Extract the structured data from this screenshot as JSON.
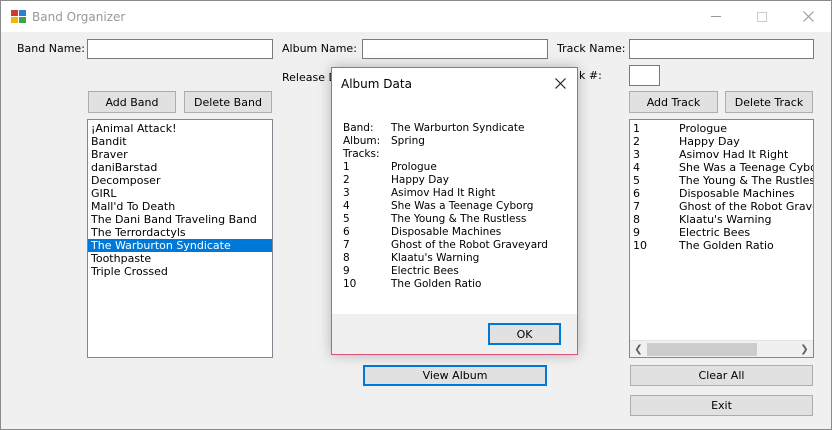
{
  "window": {
    "title": "Band Organizer"
  },
  "labels": {
    "band_name": "Band Name:",
    "album_name": "Album Name:",
    "track_name": "Track Name:",
    "release_date": "Release D",
    "track_number": "k #:"
  },
  "buttons": {
    "add_band": "Add Band",
    "delete_band": "Delete Band",
    "add_track": "Add Track",
    "delete_track": "Delete Track",
    "view_album": "View Album",
    "clear_all": "Clear All",
    "exit": "Exit"
  },
  "inputs": {
    "band_name": "",
    "album_name": "",
    "track_name": "",
    "track_number": ""
  },
  "bands": [
    "¡Animal Attack!",
    "Bandit",
    "Braver",
    "daniBarstad",
    "Decomposer",
    "GIRL",
    "Mall'd To Death",
    "The Dani Band Traveling Band",
    "The Terrordactyls",
    "The Warburton Syndicate",
    "Toothpaste",
    "Triple Crossed"
  ],
  "selected_band": "The Warburton Syndicate",
  "tracks": [
    {
      "num": "1",
      "name": "Prologue"
    },
    {
      "num": "2",
      "name": "Happy Day"
    },
    {
      "num": "3",
      "name": "Asimov Had It Right"
    },
    {
      "num": "4",
      "name": "She Was a Teenage Cyborg"
    },
    {
      "num": "5",
      "name": "The Young & The Rustless"
    },
    {
      "num": "6",
      "name": "Disposable Machines"
    },
    {
      "num": "7",
      "name": "Ghost of the Robot Graveyard"
    },
    {
      "num": "8",
      "name": "Klaatu's Warning"
    },
    {
      "num": "9",
      "name": "Electric Bees"
    },
    {
      "num": "10",
      "name": "The Golden Ratio"
    }
  ],
  "dialog": {
    "title": "Album Data",
    "band_key": "Band:",
    "band_value": "The Warburton Syndicate",
    "album_key": "Album:",
    "album_value": "Spring",
    "tracks_key": "Tracks:",
    "ok": "OK"
  },
  "icons": {
    "app": "app-icon",
    "close": "close-icon",
    "minimize": "minimize-icon",
    "maximize": "maximize-icon",
    "scroll_left": "chevron-left-icon",
    "scroll_right": "chevron-right-icon"
  },
  "colors": {
    "selection": "#0078d7",
    "dialog_border": "#d9547a",
    "window_bg": "#f0f0f0"
  }
}
